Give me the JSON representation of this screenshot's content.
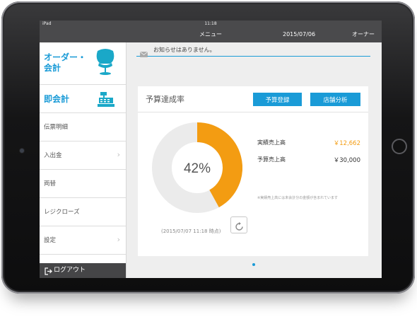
{
  "status_bar": {
    "device": "iPad",
    "time": "11:18"
  },
  "nav": {
    "title": "メニュー",
    "date": "2015/07/06",
    "user": "オーナー"
  },
  "sidebar": {
    "order_label_line1": "オーダー・",
    "order_label_line2": "会計",
    "quick_label": "即会計",
    "items": [
      {
        "label": "伝票明細",
        "chevron": false
      },
      {
        "label": "入出金",
        "chevron": true
      },
      {
        "label": "両替",
        "chevron": false
      },
      {
        "label": "レジクローズ",
        "chevron": false
      },
      {
        "label": "設定",
        "chevron": true
      }
    ],
    "logout_label": "ログアウト"
  },
  "notice": {
    "text": "お知らせはありません。"
  },
  "card": {
    "title": "予算達成率",
    "buttons": {
      "budget_register": "予算登録",
      "store_analysis": "店舗分析"
    },
    "progress": {
      "percent_value": 42,
      "percent_label": "42%"
    },
    "actual_sales": {
      "label": "実績売上高",
      "value": "￥12,662"
    },
    "budget_sales": {
      "label": "予算売上高",
      "value": "￥30,000"
    },
    "note": "※実績売上高には未会計分の金額が含まれています",
    "timestamp": "(2015/07/07 11:18 時点)"
  },
  "colors": {
    "accent": "#1a9bd7",
    "progress": "#f39c12",
    "track": "#ebebeb",
    "actual_value": "#f39c12"
  },
  "icons": {
    "order": "swan-chair-icon",
    "quick": "cash-register-icon",
    "notice": "envelope-icon",
    "refresh": "refresh-icon",
    "logout": "logout-icon",
    "chevron": "chevron-right-icon"
  }
}
